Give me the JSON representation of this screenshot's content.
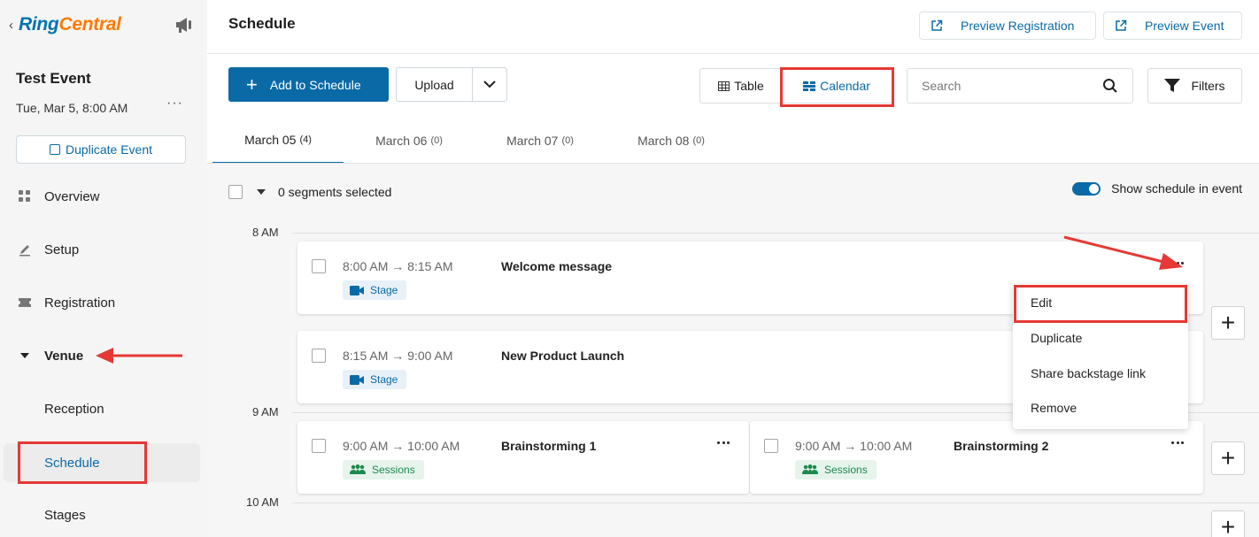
{
  "sidebar": {
    "back_glyph": "‹",
    "brand_ring": "Ring",
    "brand_central": "Central",
    "event_title": "Test Event",
    "event_date": "Tue, Mar 5, 8:00 AM",
    "more_glyph": "···",
    "duplicate_label": "Duplicate Event",
    "items": [
      {
        "label": "Overview",
        "icon": "grid-icon"
      },
      {
        "label": "Setup",
        "icon": "pencil-icon"
      },
      {
        "label": "Registration",
        "icon": "ticket-icon"
      },
      {
        "label": "Venue",
        "icon": "caret-down-icon"
      },
      {
        "label": "Reception"
      },
      {
        "label": "Schedule"
      },
      {
        "label": "Stages"
      }
    ]
  },
  "header": {
    "title": "Schedule",
    "preview_registration": "Preview Registration",
    "preview_event": "Preview Event"
  },
  "toolbar": {
    "add_label": "Add to Schedule",
    "upload_label": "Upload",
    "view_table": "Table",
    "view_calendar": "Calendar",
    "search_placeholder": "Search",
    "filters_label": "Filters"
  },
  "tabs": [
    {
      "label": "March 05",
      "count": "(4)"
    },
    {
      "label": "March 06",
      "count": "(0)"
    },
    {
      "label": "March 07",
      "count": "(0)"
    },
    {
      "label": "March 08",
      "count": "(0)"
    }
  ],
  "calendar": {
    "selected_text": "0 segments selected",
    "show_schedule_label": "Show schedule in event",
    "hours": [
      "8 AM",
      "9 AM",
      "10 AM"
    ],
    "segments": [
      {
        "start": "8:00 AM",
        "arrow": "→",
        "end": "8:15 AM",
        "title": "Welcome message",
        "type": "Stage"
      },
      {
        "start": "8:15 AM",
        "arrow": "→",
        "end": "9:00 AM",
        "title": "New Product Launch",
        "type": "Stage"
      },
      {
        "start": "9:00 AM",
        "arrow": "→",
        "end": "10:00 AM",
        "title": "Brainstorming 1",
        "type": "Sessions"
      },
      {
        "start": "9:00 AM",
        "arrow": "→",
        "end": "10:00 AM",
        "title": "Brainstorming 2",
        "type": "Sessions"
      }
    ],
    "menu": [
      "Edit",
      "Duplicate",
      "Share backstage link",
      "Remove"
    ]
  },
  "colors": {
    "accent": "#0a6aa6",
    "highlight": "#e53935",
    "sessions_green": "#1b8a4c",
    "brand_orange": "#ff7a00"
  }
}
